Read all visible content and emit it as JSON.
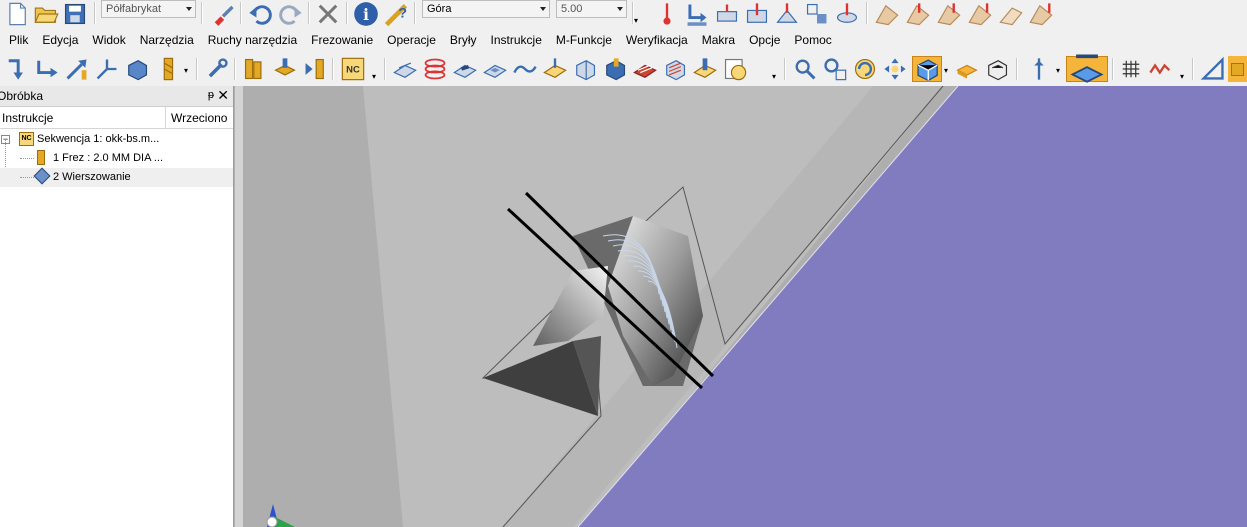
{
  "top_toolbar": {
    "stock_combo": "Półfabrykat",
    "view_combo": "Góra",
    "value_combo": "5.00"
  },
  "menu": [
    "Plik",
    "Edycja",
    "Widok",
    "Narzędzia",
    "Ruchy narzędzia",
    "Frezowanie",
    "Operacje",
    "Bryły",
    "Instrukcje",
    "M-Funkcje",
    "Weryfikacja",
    "Makra",
    "Opcje",
    "Pomoc"
  ],
  "panel": {
    "title": "Obróbka",
    "pin": "ᵽ",
    "close": "✕",
    "columns": [
      "Instrukcje",
      "Wrzeciono"
    ],
    "tree": [
      {
        "label": "Sekwencja 1: okk-bs.m..."
      },
      {
        "label": "1 Frez : 2.0 MM DIA ..."
      },
      {
        "label": "2 Wierszowanie"
      }
    ]
  },
  "colors": {
    "viewport_bg": "#aeaeae",
    "purple_plane": "#817cbf",
    "toolbar_bg": "#f0f0f0",
    "accent_orange": "#f5b43a"
  },
  "icons": [
    "new-file-icon",
    "open-folder-icon",
    "save-icon",
    "brush-icon",
    "undo-icon",
    "redo-icon",
    "delete-icon",
    "info-icon",
    "help-icon"
  ]
}
